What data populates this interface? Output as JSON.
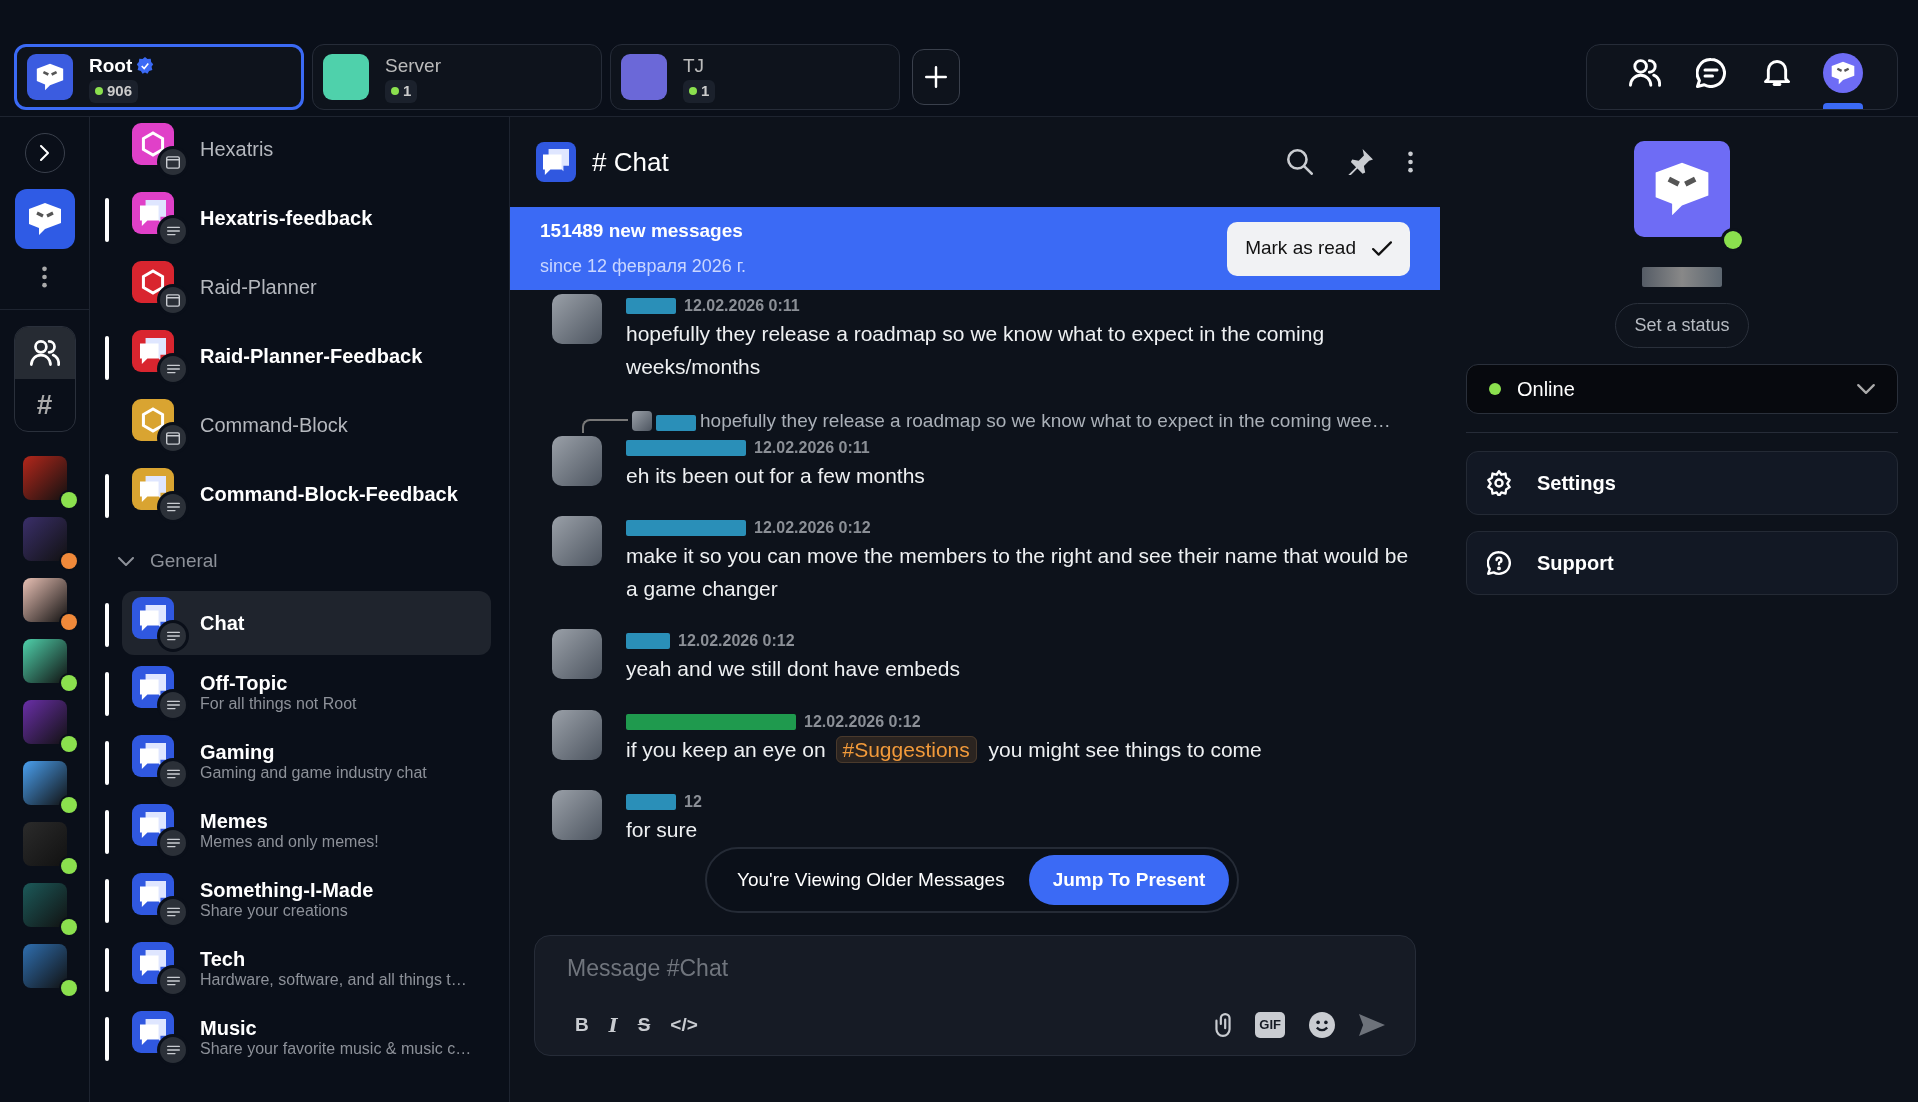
{
  "top_tabs": [
    {
      "name": "Root",
      "verified": true,
      "count": "906",
      "selected": true,
      "color": "#3b5ce0"
    },
    {
      "name": "Server",
      "verified": false,
      "count": "1",
      "selected": false,
      "color": "#4fd1ab"
    },
    {
      "name": "TJ",
      "verified": false,
      "count": "1",
      "selected": false,
      "color": "#6b68d8"
    }
  ],
  "top_actions": [
    {
      "kind": "friends",
      "selected": false
    },
    {
      "kind": "messages",
      "selected": false
    },
    {
      "kind": "notifications",
      "selected": false
    },
    {
      "kind": "profile",
      "selected": true
    }
  ],
  "rail": {
    "groups": [
      {
        "kind": "members",
        "selected": true
      },
      {
        "kind": "channels",
        "label": "#",
        "selected": false
      }
    ],
    "servers": [
      {
        "color": "#8be04e"
      },
      {
        "color": "#f0893a"
      },
      {
        "color": "#f0893a"
      },
      {
        "color": "#8be04e"
      },
      {
        "color": "#8be04e"
      },
      {
        "color": "#8be04e"
      },
      {
        "color": "#8be04e"
      },
      {
        "color": "#8be04e"
      },
      {
        "color": "#8be04e"
      }
    ]
  },
  "channels": [
    {
      "name": "Hexatris",
      "kind": "app",
      "unread": false,
      "selected": false,
      "color": "#e040c8"
    },
    {
      "name": "Hexatris-feedback",
      "kind": "text",
      "unread": true,
      "selected": false,
      "color": "#e040c8"
    },
    {
      "name": "Raid-Planner",
      "kind": "app",
      "unread": false,
      "selected": false,
      "color": "#d9252f"
    },
    {
      "name": "Raid-Planner-Feedback",
      "kind": "text",
      "unread": true,
      "selected": false,
      "color": "#d9252f"
    },
    {
      "name": "Command-Block",
      "kind": "app",
      "unread": false,
      "selected": false,
      "color": "#d9a431"
    },
    {
      "name": "Command-Block-Feedback",
      "kind": "text",
      "unread": true,
      "selected": false,
      "color": "#d9a431"
    }
  ],
  "category": {
    "label": "General",
    "expanded": true,
    "channels": [
      {
        "name": "Chat",
        "kind": "text",
        "unread": true,
        "selected": true,
        "color": "#3058e0"
      },
      {
        "name": "Off-Topic",
        "description": "For all things not Root",
        "kind": "text",
        "unread": true,
        "selected": false,
        "color": "#3058e0"
      },
      {
        "name": "Gaming",
        "description": "Gaming and game industry chat",
        "kind": "text",
        "unread": true,
        "selected": false,
        "color": "#3058e0"
      },
      {
        "name": "Memes",
        "description": "Memes and only memes!",
        "kind": "text",
        "unread": true,
        "selected": false,
        "color": "#3058e0"
      },
      {
        "name": "Something-I-Made",
        "description": "Share your creations",
        "kind": "text",
        "unread": true,
        "selected": false,
        "color": "#3058e0"
      },
      {
        "name": "Tech",
        "description": "Hardware, software, and all things t…",
        "kind": "text",
        "unread": true,
        "selected": false,
        "color": "#3058e0"
      },
      {
        "name": "Music",
        "description": "Share your favorite music & music c…",
        "kind": "text",
        "unread": true,
        "selected": false,
        "color": "#3058e0"
      }
    ]
  },
  "chat": {
    "title": "# Chat",
    "banner": {
      "title": "151489 new messages",
      "subtitle": "since 12 февраля 2026 г.",
      "button": "Mark as read"
    },
    "messages": [
      {
        "color": "#2a8fb8",
        "time": "12.02.2026 0:11",
        "segments": [
          {
            "kind": "text",
            "text": "hopefully they release a roadmap so we know what to expect in the coming weeks/months"
          }
        ]
      },
      {
        "color": "#2a8fb8",
        "reply": "hopefully they release a roadmap so we know what to expect in the coming wee…",
        "time": "12.02.2026 0:11",
        "segments": [
          {
            "kind": "text",
            "text": "eh its been out for a few months"
          }
        ]
      },
      {
        "color": "#2a8fb8",
        "time": "12.02.2026 0:12",
        "segments": [
          {
            "kind": "text",
            "text": "make it so you can move the members to the right and see their name that would be a game changer"
          }
        ]
      },
      {
        "color": "#2a8fb8",
        "time": "12.02.2026 0:12",
        "segments": [
          {
            "kind": "text",
            "text": "yeah and we still dont have embeds"
          }
        ]
      },
      {
        "color": "#1f9a4e",
        "time": "12.02.2026 0:12",
        "segments": [
          {
            "kind": "text",
            "text": "if you keep an eye on"
          },
          {
            "kind": "mention",
            "text": "#Suggestions"
          },
          {
            "kind": "text",
            "text": "you might see things to come"
          }
        ]
      },
      {
        "color": "#2a8fb8",
        "time": "12",
        "segments": [
          {
            "kind": "text",
            "text": "for sure"
          }
        ]
      }
    ],
    "older_notice": {
      "text": "You're Viewing Older Messages",
      "button": "Jump To Present"
    },
    "composer": {
      "placeholder": "Message #Chat",
      "format_buttons": [
        "B",
        "I",
        "S",
        "</>"
      ],
      "gif": "GIF"
    }
  },
  "profile": {
    "status_button": "Set a status",
    "status": {
      "label": "Online",
      "color": "#8be04e"
    },
    "menu": [
      "Settings",
      "Support"
    ]
  }
}
